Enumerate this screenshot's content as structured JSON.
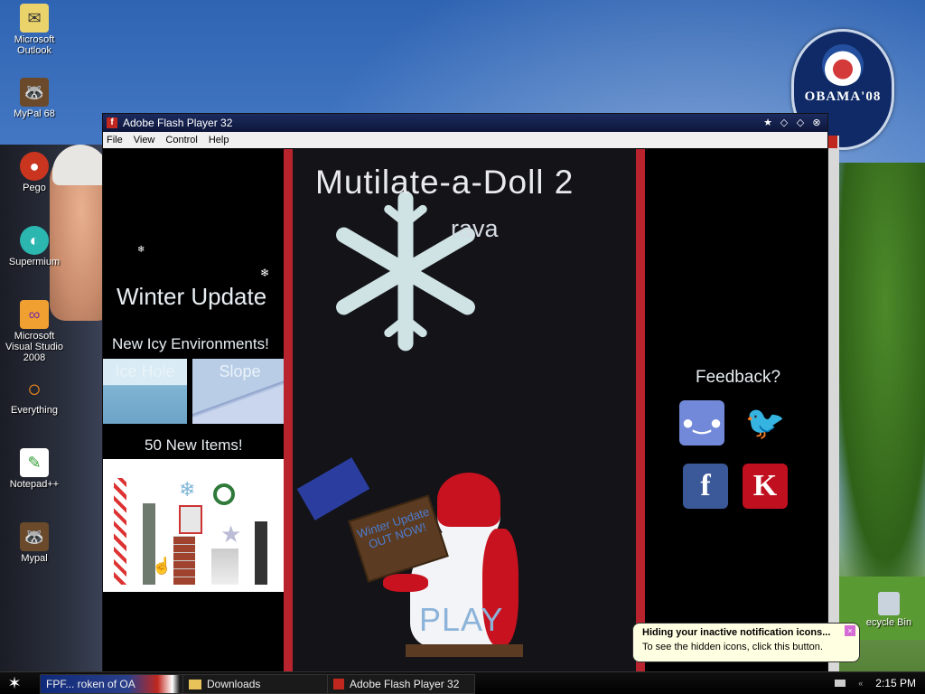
{
  "desktop": {
    "icons": [
      {
        "label": "Microsoft Outlook",
        "icon": "outlook-icon"
      },
      {
        "label": "MyPal 68",
        "icon": "raccoon-icon"
      },
      {
        "label": "Pego",
        "icon": "pego-icon"
      },
      {
        "label": "Supermium",
        "icon": "supermium-icon"
      },
      {
        "label": "Microsoft Visual Studio 2008",
        "icon": "visual-studio-icon"
      },
      {
        "label": "Everything",
        "icon": "everything-icon"
      },
      {
        "label": "Notepad++",
        "icon": "notepad-icon"
      },
      {
        "label": "Mypal",
        "icon": "raccoon-icon"
      }
    ],
    "badge": {
      "text": "OBAMA'08"
    },
    "recycle_label": "ecycle Bin"
  },
  "window": {
    "title": "Adobe Flash Player 32",
    "menu": [
      "File",
      "View",
      "Control",
      "Help"
    ]
  },
  "game": {
    "title": "Mutilate-a-Doll 2",
    "subtitle": "rava",
    "left_panel": {
      "heading": "Winter Update",
      "environments_title": "New Icy Environments!",
      "tiles": [
        "Ice Hole",
        "Slope"
      ],
      "items_title": "50 New Items!"
    },
    "sign_text": "Winter Update OUT NOW!",
    "play_label": "PLAY",
    "right_panel": {
      "feedback": "Feedback?",
      "social": [
        {
          "name": "discord",
          "glyph": "●‿●"
        },
        {
          "name": "twitter",
          "glyph": "🐦"
        },
        {
          "name": "facebook",
          "glyph": "f"
        },
        {
          "name": "kongregate",
          "glyph": "K"
        }
      ]
    },
    "colors": {
      "accent_red": "#b8232e",
      "background": "#131318"
    }
  },
  "taskbar": {
    "buttons": [
      {
        "label": "FPF... roken of OA"
      },
      {
        "label": "Downloads"
      },
      {
        "label": "Adobe Flash Player 32"
      }
    ],
    "clock": "2:15 PM"
  },
  "balloon": {
    "title": "Hiding your inactive notification icons...",
    "body": "To see the hidden icons, click this button."
  }
}
